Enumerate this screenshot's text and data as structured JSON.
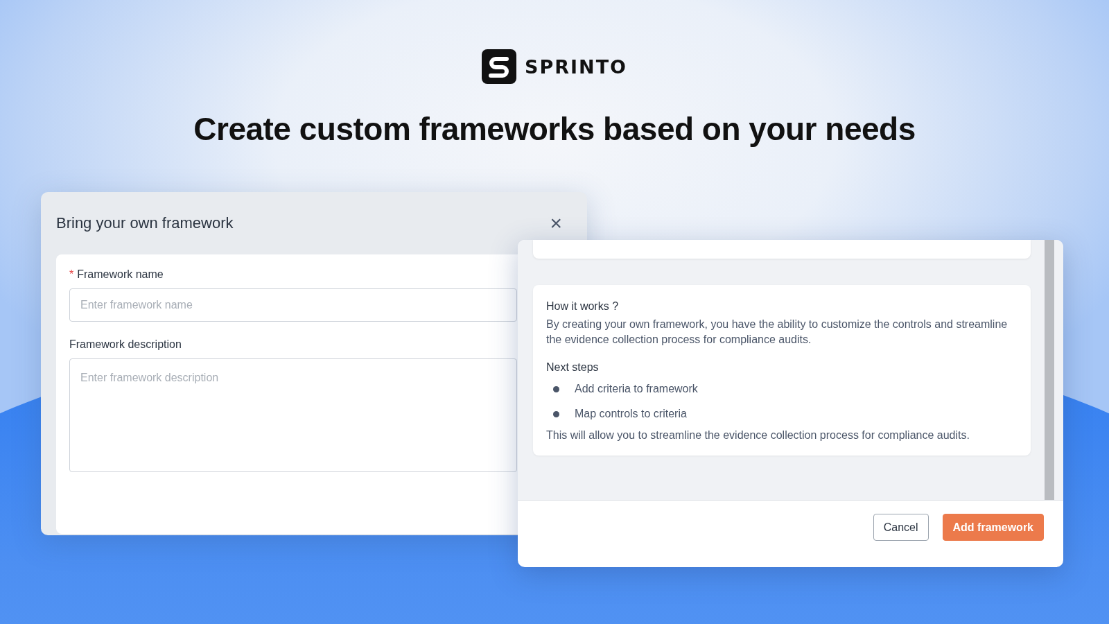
{
  "brand": {
    "name": "SPRINTO"
  },
  "headline": "Create custom frameworks based on your needs",
  "dialog": {
    "title": "Bring your own framework",
    "close": "×",
    "fields": [
      {
        "kind": "input",
        "label": "Framework name",
        "required": true,
        "required_mark": "*",
        "placeholder": "Enter framework name"
      },
      {
        "kind": "textarea",
        "label": "Framework description",
        "required": false,
        "placeholder": "Enter framework description"
      }
    ]
  },
  "info_panel": {
    "heading": "How it works ?",
    "text": "By creating your own framework, you have the ability to customize the controls and streamline the evidence collection process for compliance audits.",
    "steps_heading": "Next steps",
    "steps": [
      "Add criteria to framework",
      "Map controls to criteria"
    ],
    "note": "This will allow you to streamline the evidence collection process for compliance audits."
  },
  "buttons": [
    {
      "kind": "secondary",
      "label": "Cancel"
    },
    {
      "kind": "primary",
      "label": "Add framework"
    }
  ]
}
